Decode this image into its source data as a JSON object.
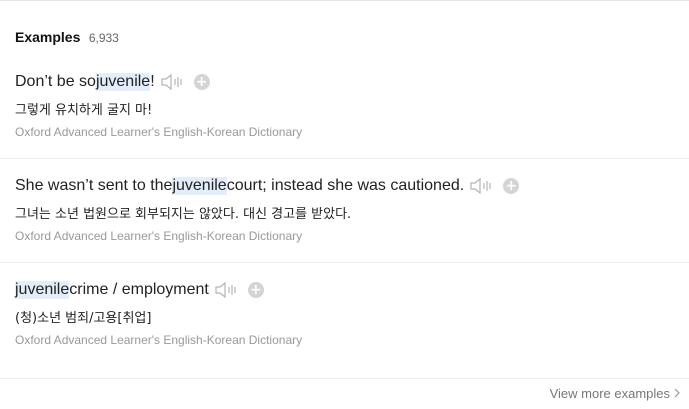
{
  "section": {
    "title": "Examples",
    "count": "6,933"
  },
  "examples": [
    {
      "before": "Don’t be so ",
      "highlight": "juvenile",
      "after": "!",
      "translation": "그렇게 유치하게 굴지 마!",
      "source": "Oxford Advanced Learner's English-Korean Dictionary"
    },
    {
      "before": "She wasn’t sent to the ",
      "highlight": "juvenile",
      "after": " court; instead she was cautioned.",
      "translation": "그녀는 소년 법원으로 회부되지는 않았다. 대신 경고를 받았다.",
      "source": "Oxford Advanced Learner's English-Korean Dictionary"
    },
    {
      "before": "",
      "highlight": "juvenile",
      "after": " crime / employment",
      "translation": "(청)소년 범죄/고용[취업]",
      "source": "Oxford Advanced Learner's English-Korean Dictionary"
    }
  ],
  "footer": {
    "view_more_label": "View more examples"
  },
  "icons": {
    "speaker": "speaker-icon",
    "add": "plus-circle-icon",
    "chevron": "chevron-right-icon"
  },
  "colors": {
    "highlight_bg": "#e4eefb",
    "source_text": "#999999",
    "icon_gray": "#bbbbbb"
  }
}
